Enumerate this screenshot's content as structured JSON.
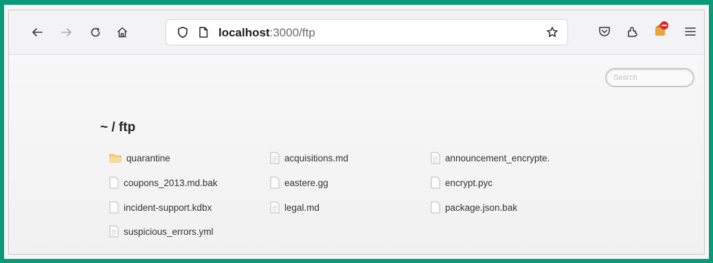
{
  "browser": {
    "url_host": "localhost",
    "url_rest": ":3000/ftp"
  },
  "page": {
    "search_placeholder": "Search",
    "breadcrumb": "~ / ftp",
    "files": [
      {
        "name": "quarantine",
        "type": "folder"
      },
      {
        "name": "coupons_2013.md.bak",
        "type": "file"
      },
      {
        "name": "incident-support.kdbx",
        "type": "file"
      },
      {
        "name": "suspicious_errors.yml",
        "type": "text"
      },
      {
        "name": "acquisitions.md",
        "type": "text"
      },
      {
        "name": "eastere.gg",
        "type": "file"
      },
      {
        "name": "legal.md",
        "type": "text"
      },
      {
        "name": "announcement_encrypte.",
        "type": "text"
      },
      {
        "name": "encrypt.pyc",
        "type": "file"
      },
      {
        "name": "package.json.bak",
        "type": "file"
      }
    ]
  },
  "colors": {
    "frame": "#0a9a77",
    "folder": "#f3d27a"
  }
}
